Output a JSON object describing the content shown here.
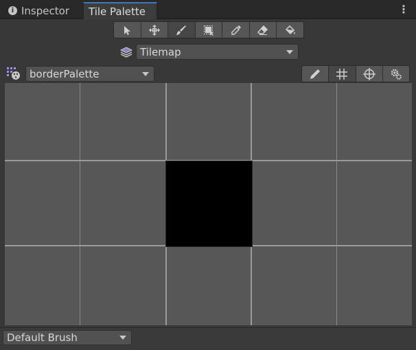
{
  "tabs": [
    {
      "label": "Inspector",
      "icon": "info-icon"
    },
    {
      "label": "Tile Palette",
      "active": true
    }
  ],
  "menu_icon": "kebab-menu-icon",
  "tools": [
    {
      "name": "select-tool",
      "icon": "arrow-cursor-icon"
    },
    {
      "name": "move-tool",
      "icon": "move-arrows-icon"
    },
    {
      "name": "paint-tool",
      "icon": "paintbrush-icon",
      "active": true
    },
    {
      "name": "box-fill-tool",
      "icon": "box-select-icon"
    },
    {
      "name": "pick-tool",
      "icon": "eyedropper-icon"
    },
    {
      "name": "erase-tool",
      "icon": "eraser-icon"
    },
    {
      "name": "flood-fill-tool",
      "icon": "paint-bucket-icon"
    }
  ],
  "target": {
    "icon": "layers-icon",
    "value": "Tilemap"
  },
  "palette": {
    "icon": "palette-icon",
    "value": "borderPalette"
  },
  "palette_tools": [
    {
      "name": "edit-palette",
      "icon": "pencil-icon"
    },
    {
      "name": "grid-toggle",
      "icon": "grid-icon",
      "active": true
    },
    {
      "name": "gizmos-toggle",
      "icon": "gizmo-icon"
    },
    {
      "name": "palette-settings",
      "icon": "settings-gear-icon"
    }
  ],
  "brush": {
    "value": "Default Brush"
  },
  "colors": {
    "accent": "#3a79bb",
    "grid_bg": "#575757",
    "tile": "#000000"
  }
}
